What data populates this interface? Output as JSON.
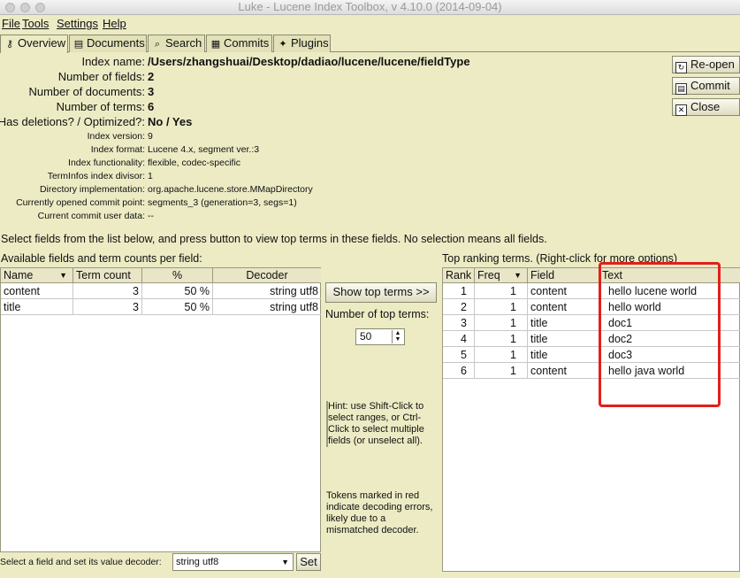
{
  "window": {
    "title": "Luke - Lucene Index Toolbox, v 4.10.0 (2014-09-04)"
  },
  "menu": [
    {
      "label": "File"
    },
    {
      "label": "Tools"
    },
    {
      "label": "Settings"
    },
    {
      "label": "Help"
    }
  ],
  "tabs": [
    {
      "label": "Overview",
      "icon": "overview-icon"
    },
    {
      "label": "Documents",
      "icon": "documents-icon"
    },
    {
      "label": "Search",
      "icon": "search-icon"
    },
    {
      "label": "Commits",
      "icon": "commits-icon"
    },
    {
      "label": "Plugins",
      "icon": "plugins-icon"
    }
  ],
  "overview": {
    "index_name_label": "Index name:",
    "index_name": "/Users/zhangshuai/Desktop/dadiao/lucene/lucene/fieldType",
    "num_fields_label": "Number of fields:",
    "num_fields": "2",
    "num_docs_label": "Number of documents:",
    "num_docs": "3",
    "num_terms_label": "Number of terms:",
    "num_terms": "6",
    "deletions_label": "Has deletions? / Optimized?:",
    "deletions": "No / Yes",
    "index_version_label": "Index version:",
    "index_version": "9",
    "index_format_label": "Index format:",
    "index_format": "Lucene 4.x, segment ver.:3",
    "index_functionality_label": "Index functionality:",
    "index_functionality": "flexible, codec-specific",
    "terminfos_label": "TermInfos index divisor:",
    "terminfos": "1",
    "dir_impl_label": "Directory implementation:",
    "dir_impl": "org.apache.lucene.store.MMapDirectory",
    "commit_point_label": "Currently opened commit point:",
    "commit_point": "segments_3 (generation=3, segs=1)",
    "commit_user_label": "Current commit user data:",
    "commit_user": "--"
  },
  "side_buttons": {
    "reopen": "Re-open",
    "commit": "Commit",
    "close": "Close"
  },
  "instructions": "Select fields from the list below, and press button to view top terms in these fields. No selection means all fields.",
  "fields_panel": {
    "title": "Available fields and term counts per field:",
    "columns": [
      "Name",
      "Term count",
      "%",
      "Decoder"
    ],
    "rows": [
      {
        "name": "content",
        "count": "3",
        "pct": "50 %",
        "decoder": "string utf8"
      },
      {
        "name": "title",
        "count": "3",
        "pct": "50 %",
        "decoder": "string utf8"
      }
    ],
    "decoder_label": "Select a field and set its value decoder:",
    "decoder_value": "string utf8",
    "set_button": "Set"
  },
  "middle": {
    "show_top_terms": "Show top terms >>",
    "num_top_terms_label": "Number of top terms:",
    "num_top_terms": "50",
    "hint1": "Hint: use Shift-Click to select ranges, or Ctrl-Click to select multiple fields (or unselect all).",
    "hint2": "Tokens marked in red indicate decoding errors, likely due to a mismatched decoder."
  },
  "top_terms": {
    "title": "Top ranking terms. (Right-click for more options)",
    "columns": [
      "Rank",
      "Freq",
      "Field",
      "Text"
    ],
    "rows": [
      {
        "rank": "1",
        "freq": "1",
        "field": "content",
        "text": "hello lucene world"
      },
      {
        "rank": "2",
        "freq": "1",
        "field": "content",
        "text": "hello world"
      },
      {
        "rank": "3",
        "freq": "1",
        "field": "title",
        "text": "doc1"
      },
      {
        "rank": "4",
        "freq": "1",
        "field": "title",
        "text": "doc2"
      },
      {
        "rank": "5",
        "freq": "1",
        "field": "title",
        "text": "doc3"
      },
      {
        "rank": "6",
        "freq": "1",
        "field": "content",
        "text": "hello java world"
      }
    ]
  },
  "colors": {
    "background": "#ecebc4",
    "highlight": "#e0201c"
  }
}
